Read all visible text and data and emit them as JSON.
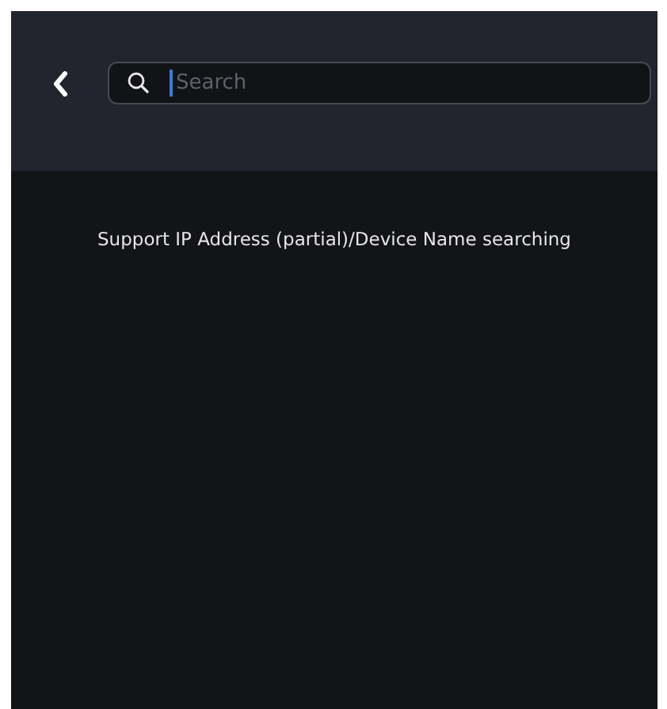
{
  "search": {
    "placeholder": "Search"
  },
  "hint": "Support IP Address (partial)/Device Name searching"
}
